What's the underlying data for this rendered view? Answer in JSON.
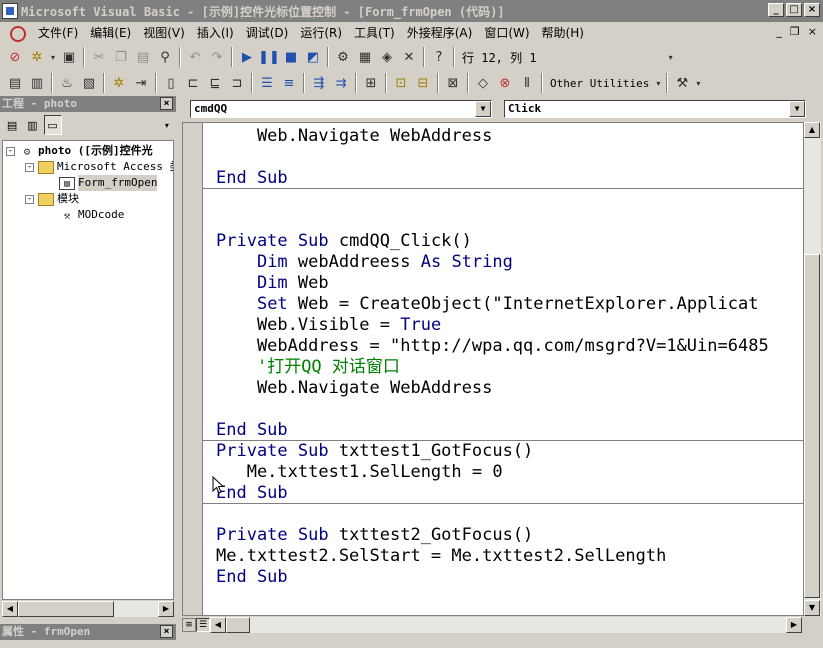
{
  "window": {
    "title": "Microsoft Visual Basic - [示例]控件光标位置控制 - [Form_frmOpen (代码)]",
    "controls": [
      "_",
      "□",
      "×"
    ]
  },
  "menubar": {
    "items": [
      "文件(F)",
      "编辑(E)",
      "视图(V)",
      "插入(I)",
      "调试(D)",
      "运行(R)",
      "工具(T)",
      "外接程序(A)",
      "窗口(W)",
      "帮助(H)"
    ],
    "mdi_controls": [
      "_",
      "❐",
      "×"
    ]
  },
  "toolbar": {
    "position": "行 12, 列 1",
    "other_utilities": "Other Utilities"
  },
  "project_panel": {
    "title": "工程 - photo",
    "tree": [
      {
        "label": "photo ([示例]控件光",
        "level": 0,
        "expander": "-",
        "icon": "project-icon",
        "bold": true
      },
      {
        "label": "Microsoft Access 类",
        "level": 1,
        "expander": "-",
        "icon": "folder-icon"
      },
      {
        "label": "Form_frmOpen",
        "level": 2,
        "icon": "form-icon",
        "selected": true
      },
      {
        "label": "模块",
        "level": 1,
        "expander": "-",
        "icon": "folder-icon"
      },
      {
        "label": "MODcode",
        "level": 2,
        "icon": "module-icon"
      }
    ]
  },
  "properties_panel": {
    "title": "属性 - frmOpen"
  },
  "editor": {
    "object_combo": "cmdQQ",
    "procedure_combo": "Click",
    "lines": [
      {
        "tokens": [
          {
            "t": "    Web.Navigate WebAddress"
          }
        ]
      },
      {
        "tokens": [
          {
            "t": ""
          }
        ]
      },
      {
        "tokens": [
          {
            "t": "End Sub",
            "k": "kw"
          }
        ]
      },
      {
        "tokens": [
          {
            "t": ""
          }
        ]
      },
      {
        "tokens": [
          {
            "t": ""
          }
        ]
      },
      {
        "tokens": [
          {
            "t": "Private Sub",
            "k": "kw"
          },
          {
            "t": " cmdQQ_Click()"
          }
        ]
      },
      {
        "tokens": [
          {
            "t": "    "
          },
          {
            "t": "Dim",
            "k": "kw"
          },
          {
            "t": " webAddreess "
          },
          {
            "t": "As String",
            "k": "kw"
          }
        ]
      },
      {
        "tokens": [
          {
            "t": "    "
          },
          {
            "t": "Dim",
            "k": "kw"
          },
          {
            "t": " Web"
          }
        ]
      },
      {
        "tokens": [
          {
            "t": "    "
          },
          {
            "t": "Set",
            "k": "kw"
          },
          {
            "t": " Web = CreateObject(\"InternetExplorer.Applicat"
          }
        ]
      },
      {
        "tokens": [
          {
            "t": "    Web.Visible = "
          },
          {
            "t": "True",
            "k": "kw"
          }
        ]
      },
      {
        "tokens": [
          {
            "t": "    WebAddress = \"http://wpa.qq.com/msgrd?V=1&Uin=6485"
          }
        ]
      },
      {
        "tokens": [
          {
            "t": "    "
          },
          {
            "t": "'打开QQ 对话窗口",
            "k": "cm"
          }
        ]
      },
      {
        "tokens": [
          {
            "t": "    Web.Navigate WebAddress"
          }
        ]
      },
      {
        "tokens": [
          {
            "t": ""
          }
        ]
      },
      {
        "tokens": [
          {
            "t": "End Sub",
            "k": "kw"
          }
        ]
      },
      {
        "tokens": [
          {
            "t": "Private Sub",
            "k": "kw"
          },
          {
            "t": " txttest1_GotFocus()"
          }
        ]
      },
      {
        "tokens": [
          {
            "t": "   Me.txttest1.SelLength = 0"
          }
        ]
      },
      {
        "tokens": [
          {
            "t": "End Sub",
            "k": "kw"
          }
        ]
      },
      {
        "tokens": [
          {
            "t": ""
          }
        ]
      },
      {
        "tokens": [
          {
            "t": "Private Sub",
            "k": "kw"
          },
          {
            "t": " txttest2_GotFocus()"
          }
        ]
      },
      {
        "tokens": [
          {
            "t": "Me.txttest2.SelStart = Me.txttest2.SelLength"
          }
        ]
      },
      {
        "tokens": [
          {
            "t": "End Sub",
            "k": "kw"
          }
        ]
      }
    ]
  },
  "colors": {
    "keyword": "#000080",
    "comment": "#008000",
    "inactive_title": "#808080"
  }
}
